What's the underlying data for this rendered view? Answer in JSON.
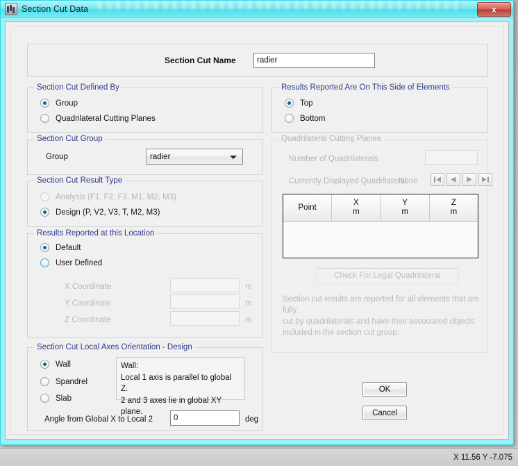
{
  "window": {
    "title": "Section Cut Data",
    "app_icon": "app-building-icon",
    "close_label": "x"
  },
  "name_panel": {
    "label": "Section Cut Name",
    "value": "radier",
    "placeholder": ""
  },
  "defined_by": {
    "legend": "Section Cut Defined By",
    "options": [
      {
        "label": "Group",
        "selected": true
      },
      {
        "label": "Quadrilateral Cutting Planes",
        "selected": false
      }
    ]
  },
  "side_of_elements": {
    "legend": "Results Reported Are On This Side of Elements",
    "options": [
      {
        "label": "Top",
        "selected": true
      },
      {
        "label": "Bottom",
        "selected": false
      }
    ]
  },
  "section_cut_group": {
    "legend": "Section Cut Group",
    "label": "Group",
    "value": "radier"
  },
  "result_type": {
    "legend": "Section Cut Result Type",
    "options": [
      {
        "label": "Analysis  (F1, F2, F3, M1, M2, M3)",
        "selected": false
      },
      {
        "label": "Design  (P, V2, V3, T, M2, M3)",
        "selected": true
      }
    ]
  },
  "results_location": {
    "legend": "Results Reported at this Location",
    "options": [
      {
        "label": "Default",
        "selected": true
      },
      {
        "label": "User Defined",
        "selected": false
      }
    ],
    "coords": [
      {
        "label": "X Coordinate",
        "value": "",
        "unit": "m"
      },
      {
        "label": "Y Coordinate",
        "value": "",
        "unit": "m"
      },
      {
        "label": "Z Coordinate",
        "value": "",
        "unit": "m"
      }
    ]
  },
  "local_axes": {
    "legend": "Section Cut Local Axes Orientation - Design",
    "options": [
      {
        "label": "Wall",
        "selected": true
      },
      {
        "label": "Spandrel",
        "selected": false
      },
      {
        "label": "Slab",
        "selected": false
      }
    ],
    "description": "Wall:\nLocal 1 axis is parallel to global Z.\n2 and 3 axes lie in global XY plane.",
    "angle_label": "Angle from Global X to Local 2",
    "angle_value": "0",
    "angle_unit": "deg"
  },
  "quad_planes": {
    "legend": "Quadrilateral Cutting Planes",
    "count_label": "Number of Quadrilaterals",
    "count_value": "",
    "current_label": "Currently Displayed Quadrilateral:",
    "current_value": "None",
    "nav": [
      {
        "name": "first",
        "glyph": "first-record-icon"
      },
      {
        "name": "previous",
        "glyph": "previous-record-icon"
      },
      {
        "name": "next",
        "glyph": "next-record-icon"
      },
      {
        "name": "last",
        "glyph": "last-record-icon"
      }
    ],
    "table": {
      "columns": [
        {
          "title": "Point",
          "unit": ""
        },
        {
          "title": "X",
          "unit": "m"
        },
        {
          "title": "Y",
          "unit": "m"
        },
        {
          "title": "Z",
          "unit": "m"
        }
      ],
      "rows": []
    },
    "check_button": "Check For Legal Quadrilateral",
    "note": "Section cut results are reported for all elements that are fully\ncut by quadrilaterals and have their associated objects\nincluded in the section cut group."
  },
  "actions": {
    "ok": "OK",
    "cancel": "Cancel"
  },
  "statusbar": {
    "coords": "X 11.56  Y -7.075"
  },
  "colors": {
    "title_cyan": "#49dfeb",
    "legend_blue": "#2e3a8c",
    "radio_dot": "#0c6a86",
    "close_red": "#b63f36",
    "disabled_gray": "#b6b6b6"
  }
}
